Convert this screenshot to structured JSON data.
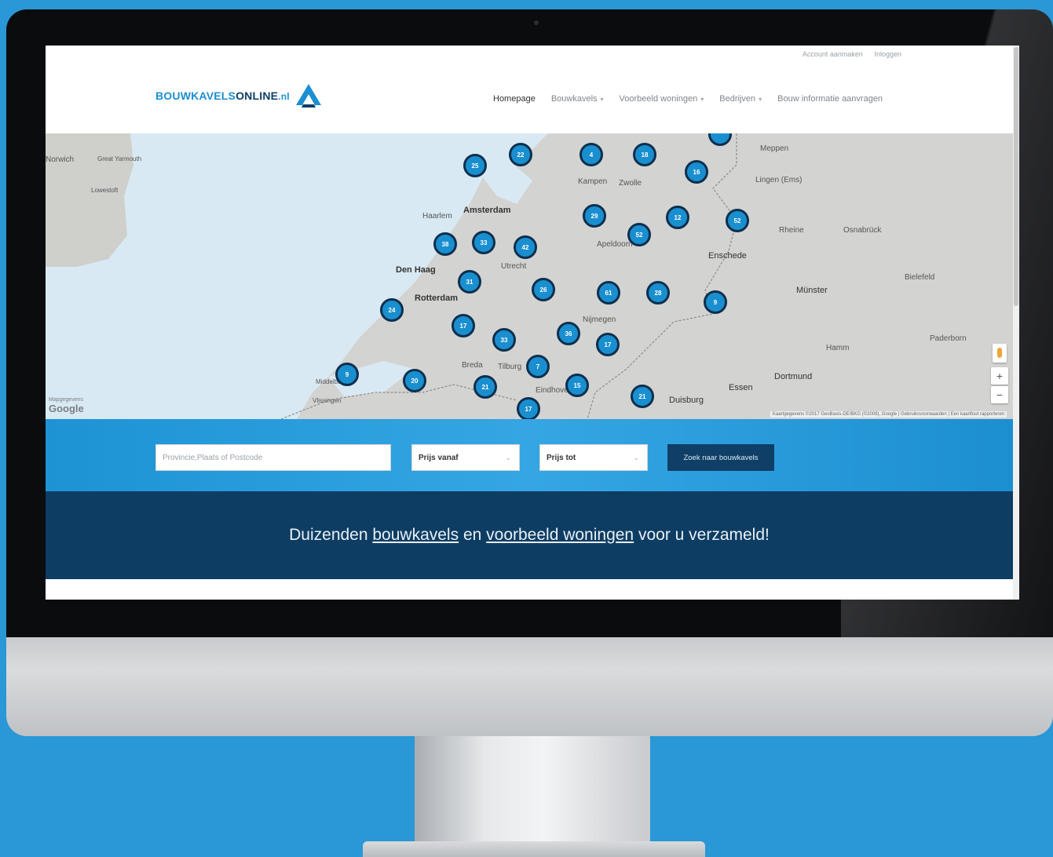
{
  "topbar": {
    "account_link": "Account aanmaken",
    "login_link": "Inloggen"
  },
  "logo": {
    "part1": "BOUWKAVELS",
    "part2": "ONLINE",
    "part3": ".nl"
  },
  "nav": {
    "items": [
      {
        "label": "Homepage",
        "dropdown": false,
        "active": true
      },
      {
        "label": "Bouwkavels",
        "dropdown": true
      },
      {
        "label": "Voorbeeld woningen",
        "dropdown": true
      },
      {
        "label": "Bedrijven",
        "dropdown": true
      },
      {
        "label": "Bouw informatie aanvragen",
        "dropdown": false
      }
    ]
  },
  "map": {
    "cities": [
      "Norwich",
      "Great Yarmouth",
      "Lowestoft",
      "Haarlem",
      "Amsterdam",
      "Den Haag",
      "Rotterdam",
      "Utrecht",
      "Breda",
      "Tilburg",
      "Eindhoven",
      "Nijmegen",
      "Apeldoorn",
      "Kampen",
      "Zwolle",
      "Enschede",
      "Münster",
      "Osnabrück",
      "Bielefeld",
      "Dortmund",
      "Essen",
      "Duisburg",
      "Hamm",
      "Paderborn",
      "Lingen (Ems)",
      "Meppen",
      "Rheine",
      "Vlissingen",
      "Middelburg"
    ],
    "clusters": [
      "25",
      "22",
      "4",
      "18",
      "",
      "16",
      "29",
      "12",
      "52",
      "38",
      "33",
      "42",
      "52",
      "31",
      "26",
      "61",
      "28",
      "9",
      "24",
      "17",
      "33",
      "36",
      "17",
      "7",
      "9",
      "20",
      "21",
      "15",
      "21",
      "17"
    ],
    "google": "Google",
    "google_sub": "Mapgegevens",
    "attribution": "Kaartgegevens ©2017 GeoBasis-DE/BKG (©2009), Google | Gebruiksvoorwaarden | Een kaartfout rapporteren",
    "zoom_in": "+",
    "zoom_out": "−"
  },
  "search": {
    "placeholder": "Provincie,Plaats of Postcode",
    "price_from": "Prijs vanaf",
    "price_to": "Prijs tot",
    "button": "Zoek naar bouwkavels"
  },
  "tagline": {
    "prefix": "Duizenden ",
    "link1": "bouwkavels",
    "middle": " en ",
    "link2": "voorbeeld woningen",
    "suffix": " voor u verzameld!"
  },
  "colors": {
    "accent": "#1b8fd1",
    "dark": "#0e3d63",
    "background": "#2a97d6"
  }
}
